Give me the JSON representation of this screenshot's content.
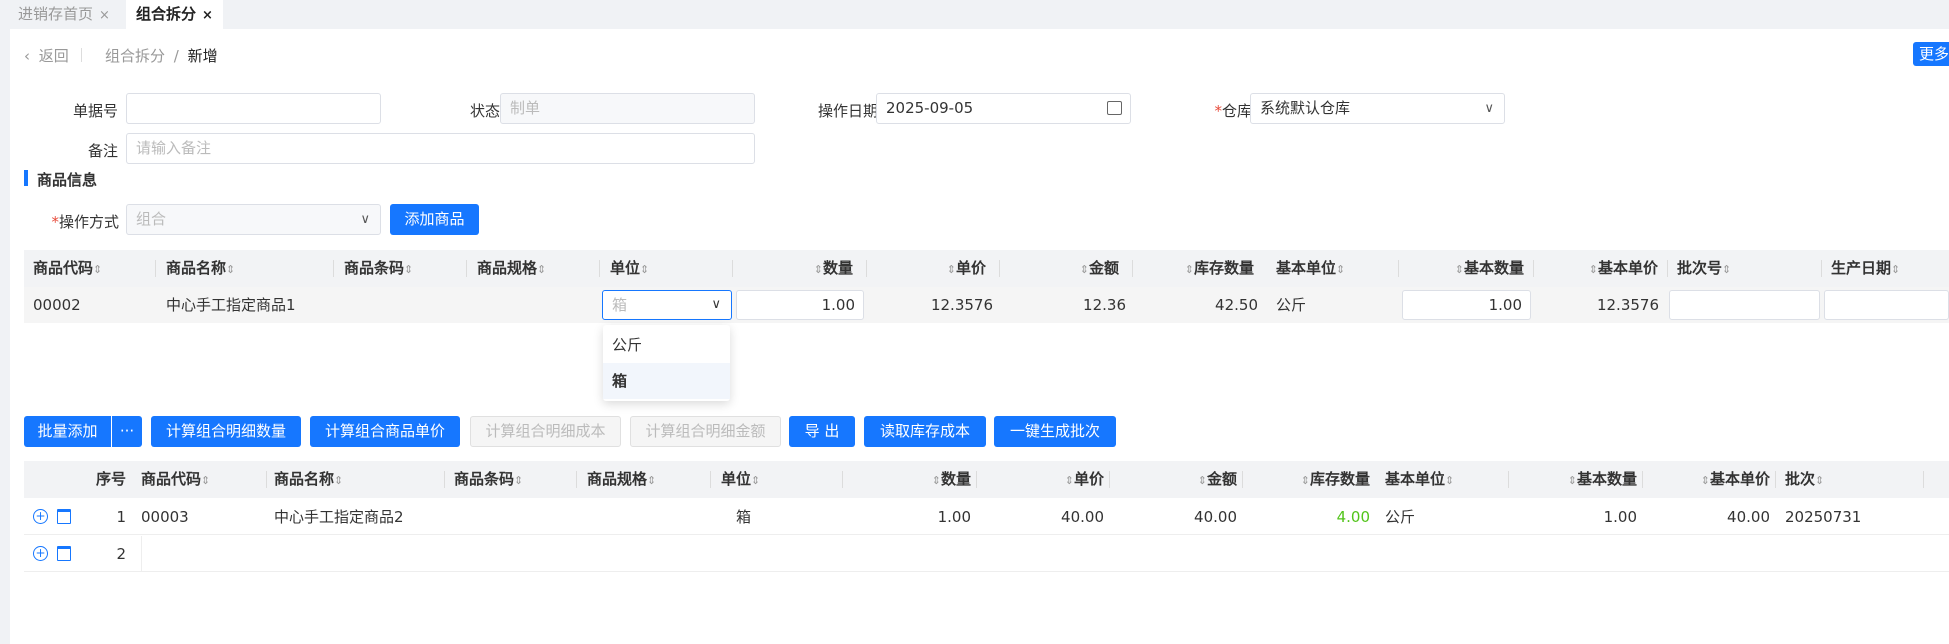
{
  "tabs": [
    {
      "label": "进销存首页",
      "close": "×",
      "active": false
    },
    {
      "label": "组合拆分",
      "close": "×",
      "active": true
    }
  ],
  "header": {
    "back_label": "返回",
    "crumb_parent": "组合拆分",
    "crumb_sep": "/",
    "crumb_current": "新增",
    "more_label": "更多"
  },
  "form": {
    "bill_no_label": "单据号",
    "bill_no_value": "",
    "status_label": "状态",
    "status_placeholder": "制单",
    "date_label": "操作日期",
    "date_value": "2025-09-05",
    "warehouse_required": "*",
    "warehouse_label": "仓库",
    "warehouse_value": "系统默认仓库",
    "remark_label": "备注",
    "remark_placeholder": "请输入备注"
  },
  "goods": {
    "section_title": "商品信息",
    "op_required": "*",
    "op_label": "操作方式",
    "op_placeholder": "组合",
    "add_button": "添加商品",
    "columns": [
      "商品代码",
      "商品名称",
      "商品条码",
      "商品规格",
      "单位",
      "数量",
      "单价",
      "金额",
      "库存数量",
      "基本单位",
      "基本数量",
      "基本单价",
      "批次号",
      "生产日期"
    ],
    "row": {
      "code": "00002",
      "name": "中心手工指定商品1",
      "barcode": "",
      "spec": "",
      "unit_placeholder": "箱",
      "qty": "1.00",
      "price": "12.3576",
      "amount": "12.36",
      "stock": "42.50",
      "base_unit": "公斤",
      "base_qty": "1.00",
      "base_price": "12.3576",
      "batch": "",
      "prod_date": ""
    },
    "unit_options": [
      {
        "label": "公斤",
        "selected": false
      },
      {
        "label": "箱",
        "selected": true
      }
    ]
  },
  "toolbar": {
    "batch_add": "批量添加",
    "more_dots": "···",
    "calc_detail_qty": "计算组合明细数量",
    "calc_unit_price": "计算组合商品单价",
    "calc_detail_cost": "计算组合明细成本",
    "calc_detail_amount": "计算组合明细金额",
    "export": "导 出",
    "read_cost": "读取库存成本",
    "gen_batch": "一键生成批次"
  },
  "detail": {
    "columns": [
      "序号",
      "商品代码",
      "商品名称",
      "商品条码",
      "商品规格",
      "单位",
      "数量",
      "单价",
      "金额",
      "库存数量",
      "基本单位",
      "基本数量",
      "基本单价",
      "批次"
    ],
    "rows": [
      {
        "no": "1",
        "code": "00003",
        "name": "中心手工指定商品2",
        "barcode": "",
        "spec": "",
        "unit": "箱",
        "qty": "1.00",
        "price": "40.00",
        "amount": "40.00",
        "stock": "4.00",
        "base_unit": "公斤",
        "base_qty": "1.00",
        "base_price": "40.00",
        "batch": "20250731"
      },
      {
        "no": "2"
      }
    ],
    "stock_color": "#52c41a"
  },
  "colors": {
    "primary": "#1677ff",
    "required": "#e74c3c"
  }
}
